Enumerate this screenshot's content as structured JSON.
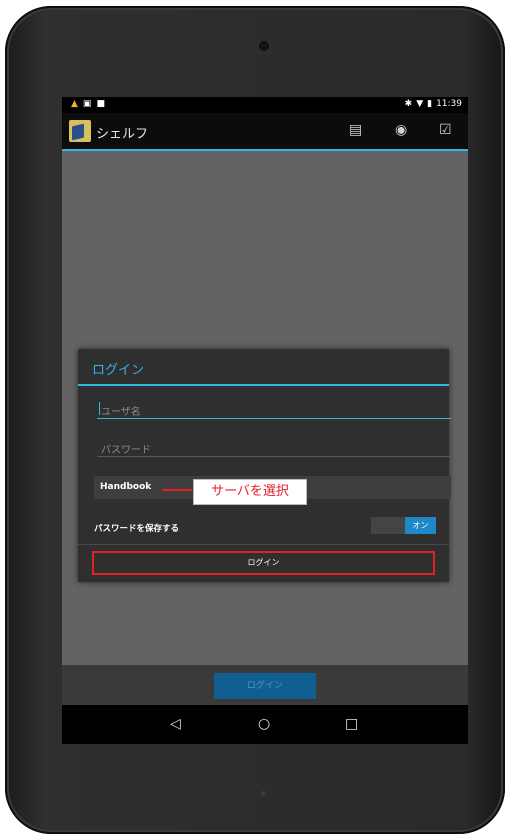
{
  "status_bar": {
    "left_icons": [
      "warning-icon",
      "image-icon",
      "store-icon"
    ],
    "right_icons": [
      "bluetooth-icon",
      "wifi-icon",
      "battery-icon"
    ],
    "time": "11:39"
  },
  "action_bar": {
    "title": "シェルフ",
    "icons": [
      "shelf-icon",
      "broadcast-icon",
      "checkbox-icon"
    ]
  },
  "dialog": {
    "title": "ログイン",
    "username_placeholder": "ユーザ名",
    "password_placeholder": "パスワード",
    "server_value": "Handbook",
    "save_password_label": "パスワードを保存する",
    "toggle_state": "オン",
    "login_button": "ログイン"
  },
  "annotation": {
    "callout_text": "サーバを選択"
  },
  "bottom_button": "ログイン",
  "nav_bar": {
    "icons": [
      "back-icon",
      "home-icon",
      "recents-icon"
    ]
  },
  "colors": {
    "accent": "#33b5e5",
    "annotation_red": "#e2202a",
    "toggle_on": "#1e88c8"
  }
}
